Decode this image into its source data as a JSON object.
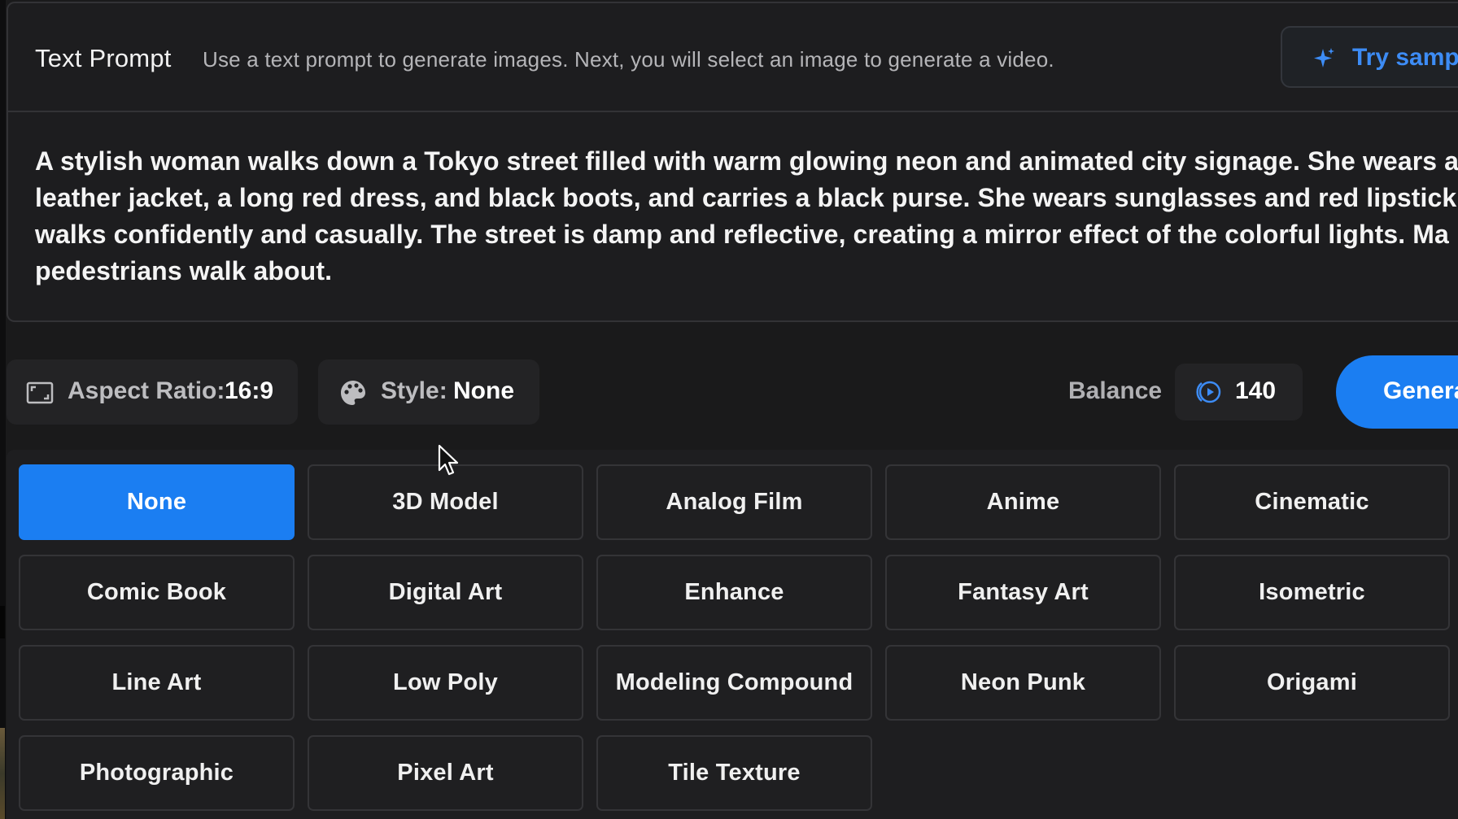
{
  "prompt": {
    "title": "Text Prompt",
    "description": "Use a text prompt to generate images. Next, you will select an image to generate a video.",
    "try_sample_label": "Try sample",
    "text": "A stylish woman walks down a Tokyo street filled with warm glowing neon and animated city signage. She wears a\nleather jacket, a long red dress, and black boots, and carries a black purse. She wears sunglasses and red lipstick.\nwalks confidently and casually. The street is damp and reflective, creating a mirror effect of the colorful lights. Ma\npedestrians walk about."
  },
  "controls": {
    "aspect_ratio_key": "Aspect Ratio:",
    "aspect_ratio_value": "16:9",
    "style_key": "Style:",
    "style_value": "None",
    "balance_label": "Balance",
    "balance_value": "140",
    "generate_label": "Generate"
  },
  "styles": {
    "selected": "None",
    "options": [
      "None",
      "3D Model",
      "Analog Film",
      "Anime",
      "Cinematic",
      "Comic Book",
      "Digital Art",
      "Enhance",
      "Fantasy Art",
      "Isometric",
      "Line Art",
      "Low Poly",
      "Modeling Compound",
      "Neon Punk",
      "Origami",
      "Photographic",
      "Pixel Art",
      "Tile Texture"
    ]
  },
  "icons": {
    "try_sample": "sparkle-icon",
    "aspect_ratio": "aspect-ratio-icon",
    "style": "palette-icon",
    "balance": "coin-icon",
    "cursor": "mouse-pointer-icon"
  },
  "colors": {
    "accent": "#1b7ef2",
    "accent_text": "#3d8cf5",
    "background": "#1a1a1b"
  }
}
